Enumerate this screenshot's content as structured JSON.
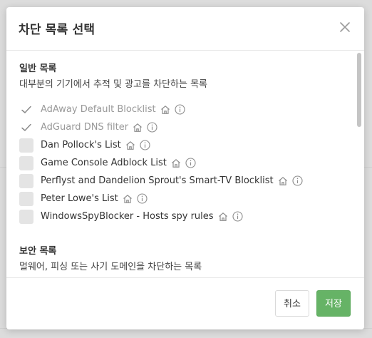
{
  "dialog": {
    "title": "차단 목록 선택",
    "close_icon": "close-icon"
  },
  "sections": [
    {
      "title": "일반 목록",
      "description": "대부분의 기기에서 추적 및 광고를 차단하는 목록",
      "items": [
        {
          "label": "AdAway Default Blocklist",
          "checked": true,
          "disabled": true
        },
        {
          "label": "AdGuard DNS filter",
          "checked": true,
          "disabled": true
        },
        {
          "label": "Dan Pollock's List",
          "checked": false,
          "disabled": false
        },
        {
          "label": "Game Console Adblock List",
          "checked": false,
          "disabled": false
        },
        {
          "label": "Perflyst and Dandelion Sprout's Smart-TV Blocklist",
          "checked": false,
          "disabled": false
        },
        {
          "label": "Peter Lowe's List",
          "checked": false,
          "disabled": false
        },
        {
          "label": "WindowsSpyBlocker - Hosts spy rules",
          "checked": false,
          "disabled": false
        }
      ]
    },
    {
      "title": "보안 목록",
      "description": "멀웨어, 피싱 또는 사기 도메인을 차단하는 목록"
    }
  ],
  "footer": {
    "cancel_label": "취소",
    "save_label": "저장"
  },
  "colors": {
    "accent": "#66b366",
    "checkbox": "#e4e4e4"
  }
}
